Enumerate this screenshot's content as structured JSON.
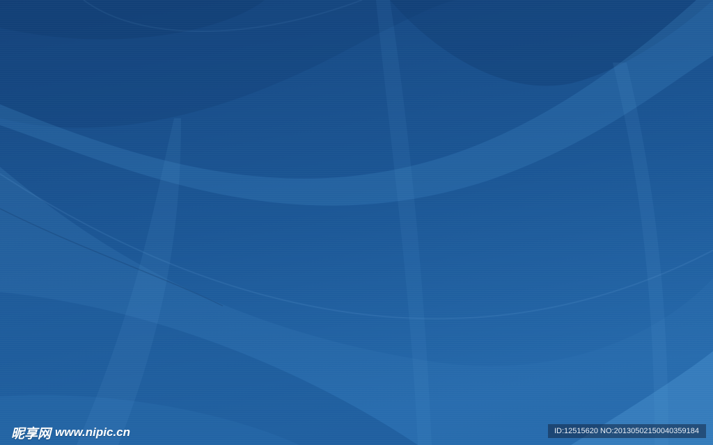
{
  "watermark": {
    "brand": "昵享网",
    "site": "www.nipic.cn",
    "id_text": "ID:12515620 NO:20130502150040359184"
  },
  "colors": {
    "background_top": "#184a86",
    "background_bottom": "#2266a8",
    "wave_light": "#3f86c4"
  }
}
